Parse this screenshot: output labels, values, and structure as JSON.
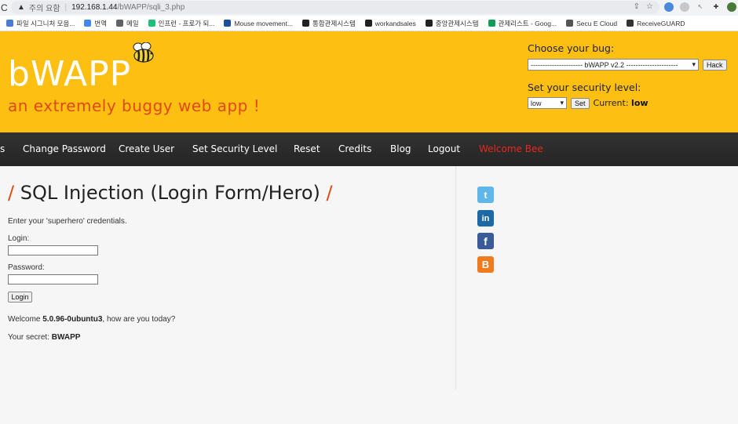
{
  "browser": {
    "security_label": "주의 요함",
    "url_host": "192.168.1.44",
    "url_path": "/bWAPP/sqli_3.php"
  },
  "bookmarks": [
    {
      "label": "파일 시그니처 모음...",
      "color": "#4a7bd8"
    },
    {
      "label": "번역",
      "color": "#4285f4"
    },
    {
      "label": "메일",
      "color": "#5f6368"
    },
    {
      "label": "인프런 - 프로가 되...",
      "color": "#1dc078"
    },
    {
      "label": "Mouse movement...",
      "color": "#1a4fa0"
    },
    {
      "label": "통합관제시스템",
      "color": "#222"
    },
    {
      "label": "workandsales",
      "color": "#222"
    },
    {
      "label": "중앙관제시스템",
      "color": "#222"
    },
    {
      "label": "관제리스트 - Goog...",
      "color": "#0f9d58"
    },
    {
      "label": "Secu E Cloud",
      "color": "#555"
    },
    {
      "label": "ReceiveGUARD",
      "color": "#333"
    }
  ],
  "header": {
    "logo": "bWAPP",
    "tagline": "an extremely buggy web app !",
    "choose_bug_label": "Choose your bug:",
    "bug_selected": "---------------------- bWAPP v2.2 ----------------------",
    "hack_label": "Hack",
    "security_label": "Set your security level:",
    "security_selected": "low",
    "set_label": "Set",
    "current_label": "Current:",
    "current_value": "low"
  },
  "nav": {
    "items": [
      "s",
      "Change Password",
      "Create User",
      "Set Security Level",
      "Reset",
      "Credits",
      "Blog",
      "Logout"
    ],
    "welcome": "Welcome Bee"
  },
  "main": {
    "title": "SQL Injection (Login Form/Hero)",
    "intro": "Enter your 'superhero' credentials.",
    "login_label": "Login:",
    "password_label": "Password:",
    "login_button": "Login",
    "welcome_prefix": "Welcome ",
    "welcome_name": "5.0.96-0ubuntu3",
    "welcome_suffix": ", how are you today?",
    "secret_prefix": "Your secret: ",
    "secret_value": "BWAPP"
  },
  "social": [
    "twitter-icon",
    "linkedin-icon",
    "facebook-icon",
    "blogger-icon"
  ]
}
